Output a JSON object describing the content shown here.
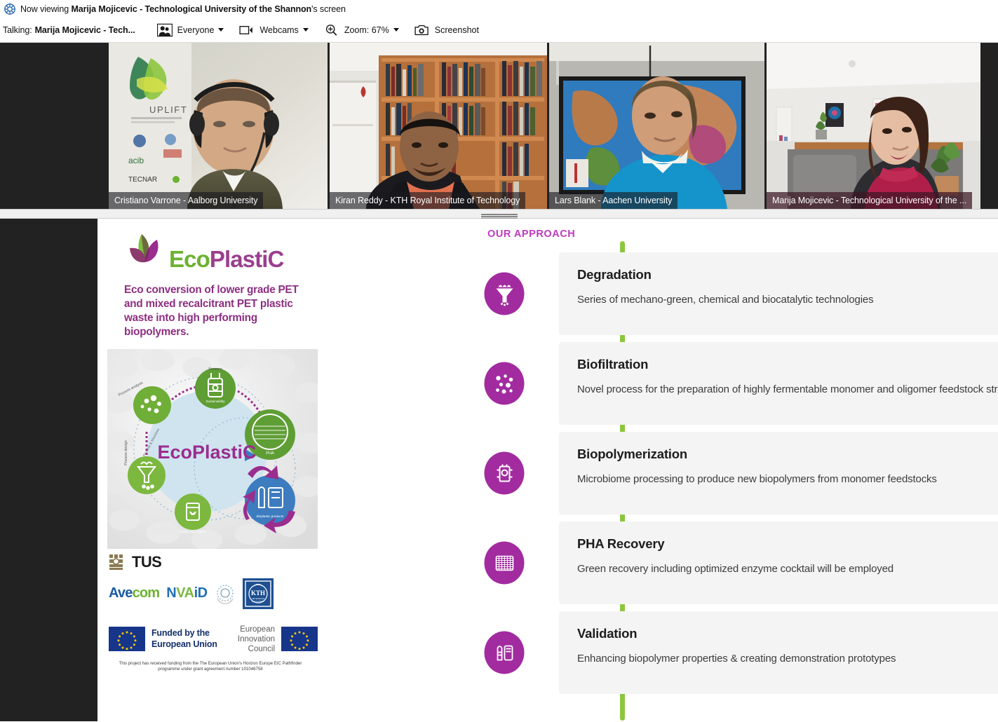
{
  "titlebar": {
    "icon": "app-logo-icon",
    "prefix": "Now viewing ",
    "presenter": "Marija Mojicevic - Technological University of the Shannon",
    "suffix": "'s screen"
  },
  "toolbar": {
    "talking_label": "Talking:",
    "talking_name": "Marija Mojicevic  -  Tech...",
    "everyone_label": "Everyone",
    "webcams_label": "Webcams",
    "zoom_label": "Zoom: 67%",
    "screenshot_label": "Screenshot"
  },
  "participants": [
    {
      "name": "Cristiano Varrone - Aalborg University",
      "active": false
    },
    {
      "name": "Kiran Reddy - KTH Royal Institute of Technology",
      "active": false
    },
    {
      "name": "Lars Blank - Aachen University",
      "active": false
    },
    {
      "name": "Marija Mojicevic - Technological University of the ...",
      "active": true
    }
  ],
  "slide": {
    "logo_word_green": "Eco",
    "logo_word_purple": "PlastiC",
    "tagline": "Eco conversion of lower grade PET and mixed recalcitrant PET plastic waste into high performing biopolymers.",
    "diagram_center_label": "EcoPlastiC",
    "diagram_node_labels": [
      "Process analysis",
      "Process & Microbes",
      "Process design",
      "Sensors",
      "Sustainability",
      "PHA",
      "Bioplastic products"
    ],
    "approach_title": "OUR APPROACH",
    "steps": [
      {
        "icon": "funnel-degradation-icon",
        "title": "Degradation",
        "desc": "Series of mechano-green, chemical and biocatalytic technologies"
      },
      {
        "icon": "molecules-biofiltration-icon",
        "title": "Biofiltration",
        "desc": "Novel process for the preparation of highly fermentable monomer and oligomer feedstock streams"
      },
      {
        "icon": "bioreactor-icon",
        "title": "Biopolymerization",
        "desc": "Microbiome processing to produce new biopolymers from monomer feedstocks"
      },
      {
        "icon": "membrane-recovery-icon",
        "title": "PHA Recovery",
        "desc": "Green recovery including optimized enzyme cocktail will be employed"
      },
      {
        "icon": "bottles-validation-icon",
        "title": "Validation",
        "desc": "Enhancing biopolymer properties & creating demonstration prototypes"
      }
    ],
    "partners": {
      "tus": "TUS",
      "avecom_a": "Ave",
      "avecom_b": "com",
      "novaid_a": "N",
      "novaid_b": "VA",
      "novaid_c": "iD",
      "kth_label": "KTH",
      "eu_funding": "Funded by the\nEuropean Union",
      "eic": "European\nInnovation\nCouncil",
      "disclaimer": "This project has received funding from the The European Union's Horizon Europe EIC Pathfinder programme under grant agreement number 101046758"
    }
  },
  "colors": {
    "brand_purple": "#a22ba0",
    "brand_green": "#8cc63e",
    "active_speaker_border": "#1fc78f",
    "dark_bg": "#222222"
  }
}
